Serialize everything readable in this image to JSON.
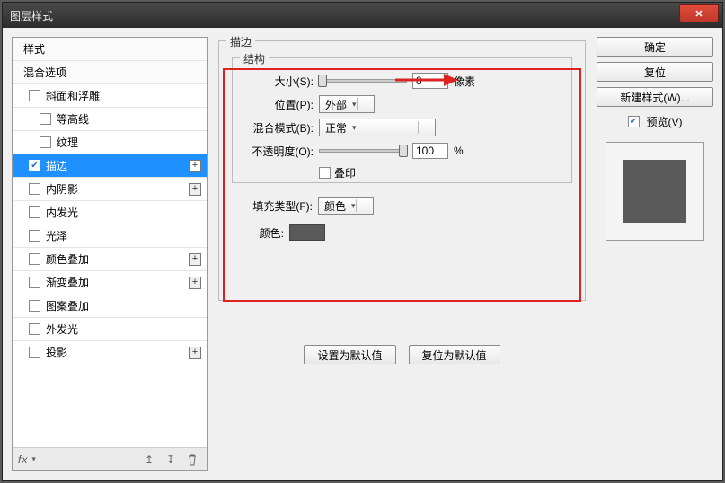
{
  "window": {
    "title": "图层样式"
  },
  "close": {
    "glyph": "✕"
  },
  "left": {
    "head_styles": "样式",
    "head_blend": "混合选项",
    "items": [
      {
        "label": "斜面和浮雕",
        "plus": false,
        "checked": false
      },
      {
        "label": "等高线",
        "plus": false,
        "checked": false
      },
      {
        "label": "纹理",
        "plus": false,
        "checked": false
      },
      {
        "label": "描边",
        "plus": true,
        "checked": true,
        "selected": true
      },
      {
        "label": "内阴影",
        "plus": true,
        "checked": false
      },
      {
        "label": "内发光",
        "plus": false,
        "checked": false
      },
      {
        "label": "光泽",
        "plus": false,
        "checked": false
      },
      {
        "label": "颜色叠加",
        "plus": true,
        "checked": false
      },
      {
        "label": "渐变叠加",
        "plus": true,
        "checked": false
      },
      {
        "label": "图案叠加",
        "plus": false,
        "checked": false
      },
      {
        "label": "外发光",
        "plus": false,
        "checked": false
      },
      {
        "label": "投影",
        "plus": true,
        "checked": false
      }
    ],
    "fx": "fx"
  },
  "mid": {
    "outer_label": "描边",
    "struct_label": "结构",
    "size_label": "大小(S):",
    "size_value": "8",
    "size_unit": "像素",
    "position_label": "位置(P):",
    "position_value": "外部",
    "blend_label": "混合模式(B):",
    "blend_value": "正常",
    "opacity_label": "不透明度(O):",
    "opacity_value": "100",
    "opacity_unit": "%",
    "overprint_label": "叠印",
    "fill_type_label": "填充类型(F):",
    "fill_type_value": "颜色",
    "color_label": "颜色:",
    "btn_default": "设置为默认值",
    "btn_reset": "复位为默认值"
  },
  "right": {
    "ok": "确定",
    "cancel": "复位",
    "new_style": "新建样式(W)...",
    "preview_label": "预览(V)"
  }
}
